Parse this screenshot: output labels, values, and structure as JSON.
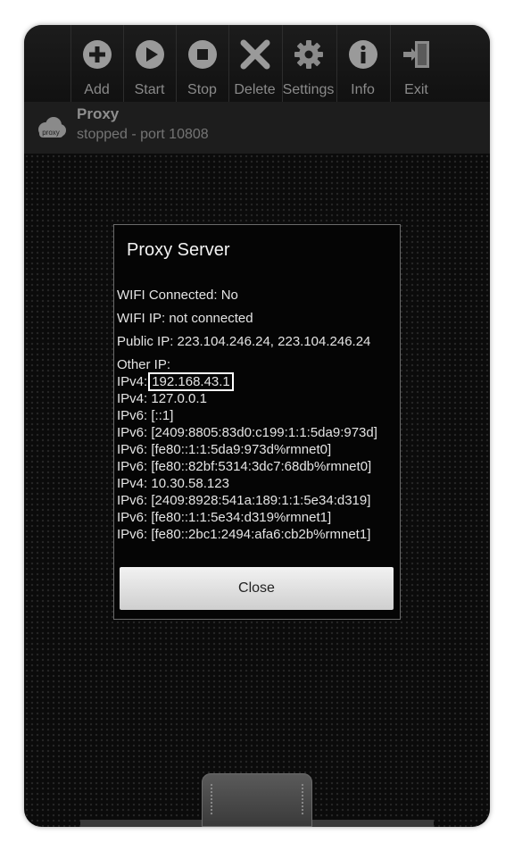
{
  "toolbar": {
    "buttons": [
      {
        "label": "Add",
        "icon": "add-icon"
      },
      {
        "label": "Start",
        "icon": "play-icon"
      },
      {
        "label": "Stop",
        "icon": "stop-icon"
      },
      {
        "label": "Delete",
        "icon": "delete-icon"
      },
      {
        "label": "Settings",
        "icon": "gear-icon"
      },
      {
        "label": "Info",
        "icon": "info-icon"
      },
      {
        "label": "Exit",
        "icon": "exit-icon"
      }
    ]
  },
  "proxy": {
    "logo_text": "proxy",
    "name": "Proxy",
    "status": "stopped - port 10808"
  },
  "dialog": {
    "title": "Proxy Server",
    "wifi_connected": "WIFI Connected: No",
    "wifi_ip": "WIFI IP: not connected",
    "public_ip": "Public IP: 223.104.246.24, 223.104.246.24",
    "other_ip_label": "Other IP:",
    "highlighted_prefix": "IPv4:",
    "highlighted_ip": "192.168.43.1",
    "ip_lines": [
      "IPv4: 127.0.0.1",
      "IPv6: [::1]",
      "IPv6: [2409:8805:83d0:c199:1:1:5da9:973d]",
      "IPv6: [fe80::1:1:5da9:973d%rmnet0]",
      "IPv6: [fe80::82bf:5314:3dc7:68db%rmnet0]",
      "IPv4: 10.30.58.123",
      "IPv6: [2409:8928:541a:189:1:1:5e34:d319]",
      "IPv6: [fe80::1:1:5e34:d319%rmnet1]",
      "IPv6: [fe80::2bc1:2494:afa6:cb2b%rmnet1]"
    ],
    "close_label": "Close"
  }
}
